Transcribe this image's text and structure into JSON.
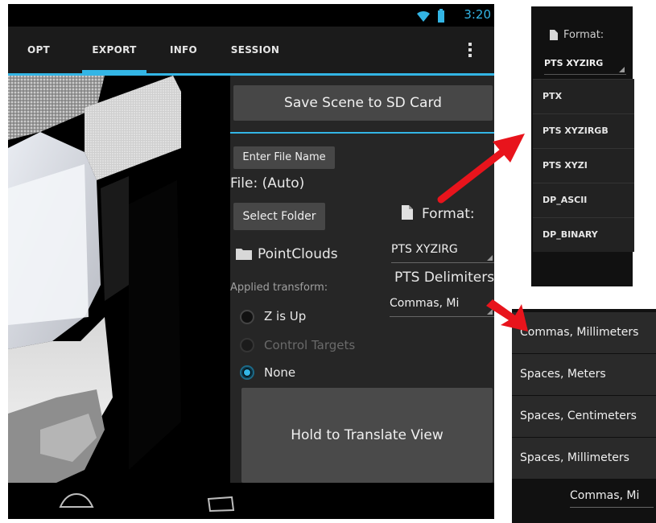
{
  "status": {
    "time": "3:20"
  },
  "tabs": [
    {
      "label": "OPT",
      "active": false
    },
    {
      "label": "EXPORT",
      "active": true
    },
    {
      "label": "INFO",
      "active": false
    },
    {
      "label": "SESSION",
      "active": false
    }
  ],
  "panel": {
    "save_button": "Save Scene to SD Card",
    "enter_file_button": "Enter File Name",
    "file_label": "File: (Auto)",
    "select_folder_button": "Select Folder",
    "folder_name": "PointClouds",
    "applied_transform_label": "Applied transform:",
    "transform_options": [
      {
        "label": "Z is Up",
        "selected": false,
        "enabled": true
      },
      {
        "label": "Control Targets",
        "selected": false,
        "enabled": false
      },
      {
        "label": "None",
        "selected": true,
        "enabled": true
      }
    ],
    "format_label": "Format:",
    "format_value": "PTS XYZIRG",
    "delimiters_label": "PTS Delimiters:",
    "delimiters_value": "Commas, Mi",
    "hold_translate_button": "Hold to Translate View"
  },
  "format_popup": {
    "label": "Format:",
    "value": "PTS XYZIRG",
    "options": [
      "PTX",
      "PTS XYZIRGB",
      "PTS XYZI",
      "DP_ASCII",
      "DP_BINARY"
    ]
  },
  "delimiters_popup": {
    "options": [
      "Commas, Millimeters",
      "Spaces, Meters",
      "Spaces, Centimeters",
      "Spaces, Millimeters"
    ],
    "current_value": "Commas, Mi"
  },
  "colors": {
    "accent": "#33b5e5",
    "arrow": "#e8141c"
  }
}
